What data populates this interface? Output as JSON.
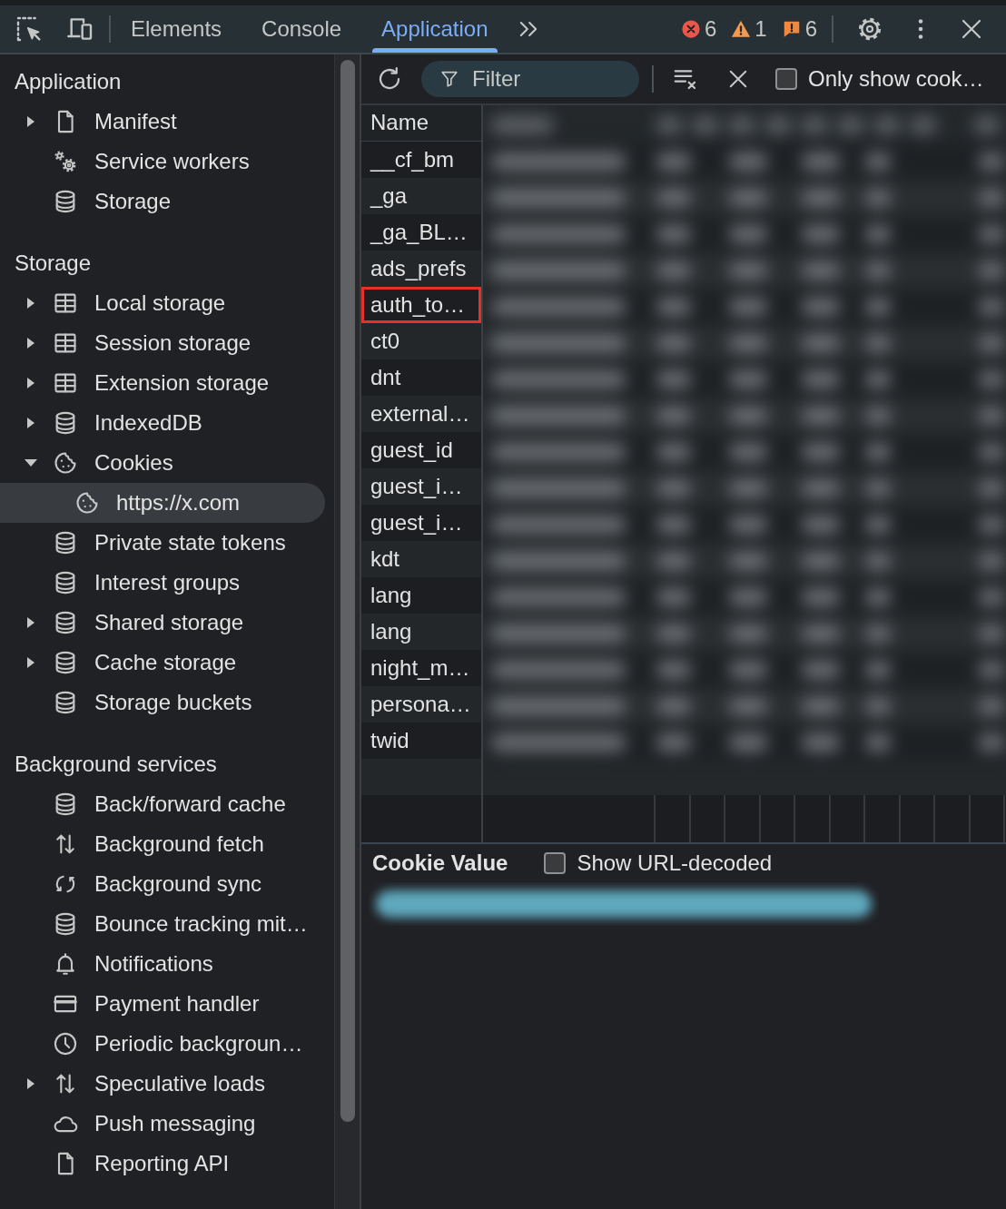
{
  "toolbar": {
    "tabs": [
      {
        "label": "Elements",
        "selected": false
      },
      {
        "label": "Console",
        "selected": false
      },
      {
        "label": "Application",
        "selected": true
      }
    ],
    "counters": [
      {
        "kind": "error",
        "count": "6"
      },
      {
        "kind": "warning",
        "count": "1"
      },
      {
        "kind": "issue",
        "count": "6"
      }
    ]
  },
  "sidebar": {
    "sections": [
      {
        "title": "Application",
        "items": [
          {
            "label": "Manifest",
            "kind": "document",
            "expanded": false,
            "selected": false
          },
          {
            "label": "Service workers",
            "kind": "gears",
            "selected": false
          },
          {
            "label": "Storage",
            "kind": "database",
            "selected": false
          }
        ]
      },
      {
        "title": "Storage",
        "items": [
          {
            "label": "Local storage",
            "kind": "table",
            "expanded": false,
            "selected": false
          },
          {
            "label": "Session storage",
            "kind": "table",
            "expanded": false,
            "selected": false
          },
          {
            "label": "Extension storage",
            "kind": "table",
            "expanded": false,
            "selected": false
          },
          {
            "label": "IndexedDB",
            "kind": "database",
            "expanded": false,
            "selected": false
          },
          {
            "label": "Cookies",
            "kind": "cookie",
            "expanded": true,
            "selected": false,
            "children": [
              {
                "label": "https://x.com",
                "kind": "cookie",
                "selected": true
              }
            ]
          },
          {
            "label": "Private state tokens",
            "kind": "database",
            "selected": false
          },
          {
            "label": "Interest groups",
            "kind": "database",
            "selected": false
          },
          {
            "label": "Shared storage",
            "kind": "database",
            "expanded": false,
            "selected": false
          },
          {
            "label": "Cache storage",
            "kind": "database",
            "expanded": false,
            "selected": false
          },
          {
            "label": "Storage buckets",
            "kind": "database",
            "selected": false
          }
        ]
      },
      {
        "title": "Background services",
        "items": [
          {
            "label": "Back/forward cache",
            "kind": "database",
            "selected": false
          },
          {
            "label": "Background fetch",
            "kind": "arrows",
            "selected": false
          },
          {
            "label": "Background sync",
            "kind": "sync",
            "selected": false
          },
          {
            "label": "Bounce tracking mit…",
            "kind": "database",
            "selected": false
          },
          {
            "label": "Notifications",
            "kind": "bell",
            "selected": false
          },
          {
            "label": "Payment handler",
            "kind": "card",
            "selected": false
          },
          {
            "label": "Periodic backgroun…",
            "kind": "clock",
            "selected": false
          },
          {
            "label": "Speculative loads",
            "kind": "arrows",
            "expanded": false,
            "selected": false
          },
          {
            "label": "Push messaging",
            "kind": "cloud",
            "selected": false
          },
          {
            "label": "Reporting API",
            "kind": "document",
            "selected": false
          }
        ]
      }
    ]
  },
  "cookie_toolbar": {
    "filter": {
      "placeholder": "Filter"
    },
    "only_show": {
      "label": "Only show cook…",
      "checked": false
    }
  },
  "table": {
    "columns": [
      {
        "label": "Name"
      }
    ],
    "redacted": true,
    "rows": [
      {
        "name": "__cf_bm",
        "highlighted": false
      },
      {
        "name": "_ga",
        "highlighted": false
      },
      {
        "name": "_ga_BL…",
        "highlighted": false
      },
      {
        "name": "ads_prefs",
        "highlighted": false
      },
      {
        "name": "auth_to…",
        "highlighted": true
      },
      {
        "name": "ct0",
        "highlighted": false
      },
      {
        "name": "dnt",
        "highlighted": false
      },
      {
        "name": "external…",
        "highlighted": false
      },
      {
        "name": "guest_id",
        "highlighted": false
      },
      {
        "name": "guest_i…",
        "highlighted": false
      },
      {
        "name": "guest_i…",
        "highlighted": false
      },
      {
        "name": "kdt",
        "highlighted": false
      },
      {
        "name": "lang",
        "highlighted": false
      },
      {
        "name": "lang",
        "highlighted": false
      },
      {
        "name": "night_m…",
        "highlighted": false
      },
      {
        "name": "persona…",
        "highlighted": false
      },
      {
        "name": "twid",
        "highlighted": false
      }
    ]
  },
  "cookie_value": {
    "title": "Cookie Value",
    "decode_toggle": {
      "label": "Show URL-decoded",
      "checked": false
    },
    "redacted": true
  }
}
